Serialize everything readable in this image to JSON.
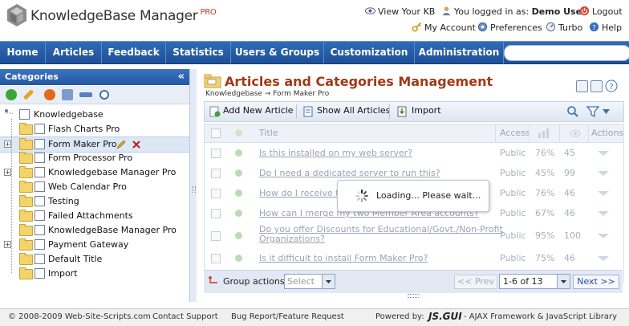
{
  "app": {
    "logo_text": "KnowledgeBase Manager",
    "logo_badge": "PRO"
  },
  "top_links": {
    "view_kb": "View Your KB",
    "logged_in_prefix": "You logged in as:",
    "user_name": "Demo User",
    "logout": "Logout",
    "my_account": "My Account",
    "preferences": "Preferences",
    "turbo": "Turbo",
    "help": "Help"
  },
  "nav": {
    "items": [
      "Home",
      "Articles",
      "Feedback",
      "Statistics",
      "Users & Groups",
      "Customization",
      "Administration"
    ]
  },
  "left_panel": {
    "title": "Categories",
    "collapse_glyph": "«",
    "tree": [
      {
        "label": "Knowledgebase",
        "level": 0,
        "expandable": false
      },
      {
        "label": "Flash Charts Pro",
        "level": 1,
        "expandable": false
      },
      {
        "label": "Form Maker Pro",
        "level": 1,
        "expandable": true,
        "selected": true
      },
      {
        "label": "Form Processor Pro",
        "level": 1,
        "expandable": false
      },
      {
        "label": "Knowledgebase Manager Pro",
        "level": 1,
        "expandable": true
      },
      {
        "label": "Web Calendar Pro",
        "level": 1,
        "expandable": false
      },
      {
        "label": "Testing",
        "level": 1,
        "expandable": false
      },
      {
        "label": "Failed Attachments",
        "level": 1,
        "expandable": false
      },
      {
        "label": "KnowledgeBase Manager Pro",
        "level": 1,
        "expandable": false
      },
      {
        "label": "Payment Gateway",
        "level": 1,
        "expandable": true
      },
      {
        "label": "Default Title",
        "level": 1,
        "expandable": false
      },
      {
        "label": "Import",
        "level": 1,
        "expandable": false
      }
    ]
  },
  "main": {
    "title": "Articles and Categories Management",
    "breadcrumb": "Knowledgebase → Form Maker Pro",
    "toolbar": {
      "add_new": "Add New Article",
      "show_all": "Show All Articles",
      "import": "Import"
    },
    "grid": {
      "columns": [
        "Title",
        "Access",
        "Actions"
      ],
      "rows": [
        {
          "title": "Is this installed on my web server?",
          "access": "Public",
          "rating": "76%",
          "views": "45"
        },
        {
          "title": "Do I need a dedicated server to run this?",
          "access": "Public",
          "rating": "45%",
          "views": "99"
        },
        {
          "title": "How do I receive the",
          "access": "Public",
          "rating": "76%",
          "views": "46"
        },
        {
          "title": "How can I merge my two Member Area accounts?",
          "access": "Public",
          "rating": "67%",
          "views": "46"
        },
        {
          "title_line1": "Do you offer Discounts for Educational/Govt./Non-Profit",
          "title_line2": "Organizations?",
          "access": "Public",
          "rating": "95%",
          "views": "100"
        },
        {
          "title": "Is it difficult to install Form Maker Pro?",
          "access": "Public",
          "rating": "75%",
          "views": "46"
        }
      ],
      "loading_text": "Loading... Please wait...",
      "group_actions_label": "Group actions:",
      "group_actions_value": "Select",
      "prev_label": "<< Prev",
      "pager_value": "1-6 of 13",
      "next_label": "Next >>"
    }
  },
  "footer": {
    "copyright": "© 2008-2009  Web-Site-Scripts.com",
    "contact": "Contact Support",
    "bug_report": "Bug Report/Feature Request",
    "powered_by": "Powered by:",
    "jsgui": "JS.GUI",
    "tagline": "- AJAX Framework & JavaScript Library"
  },
  "colors": {
    "nav_blue": "#2457a1",
    "title_brown": "#a13a16",
    "link_blue": "#1f4fa8"
  }
}
